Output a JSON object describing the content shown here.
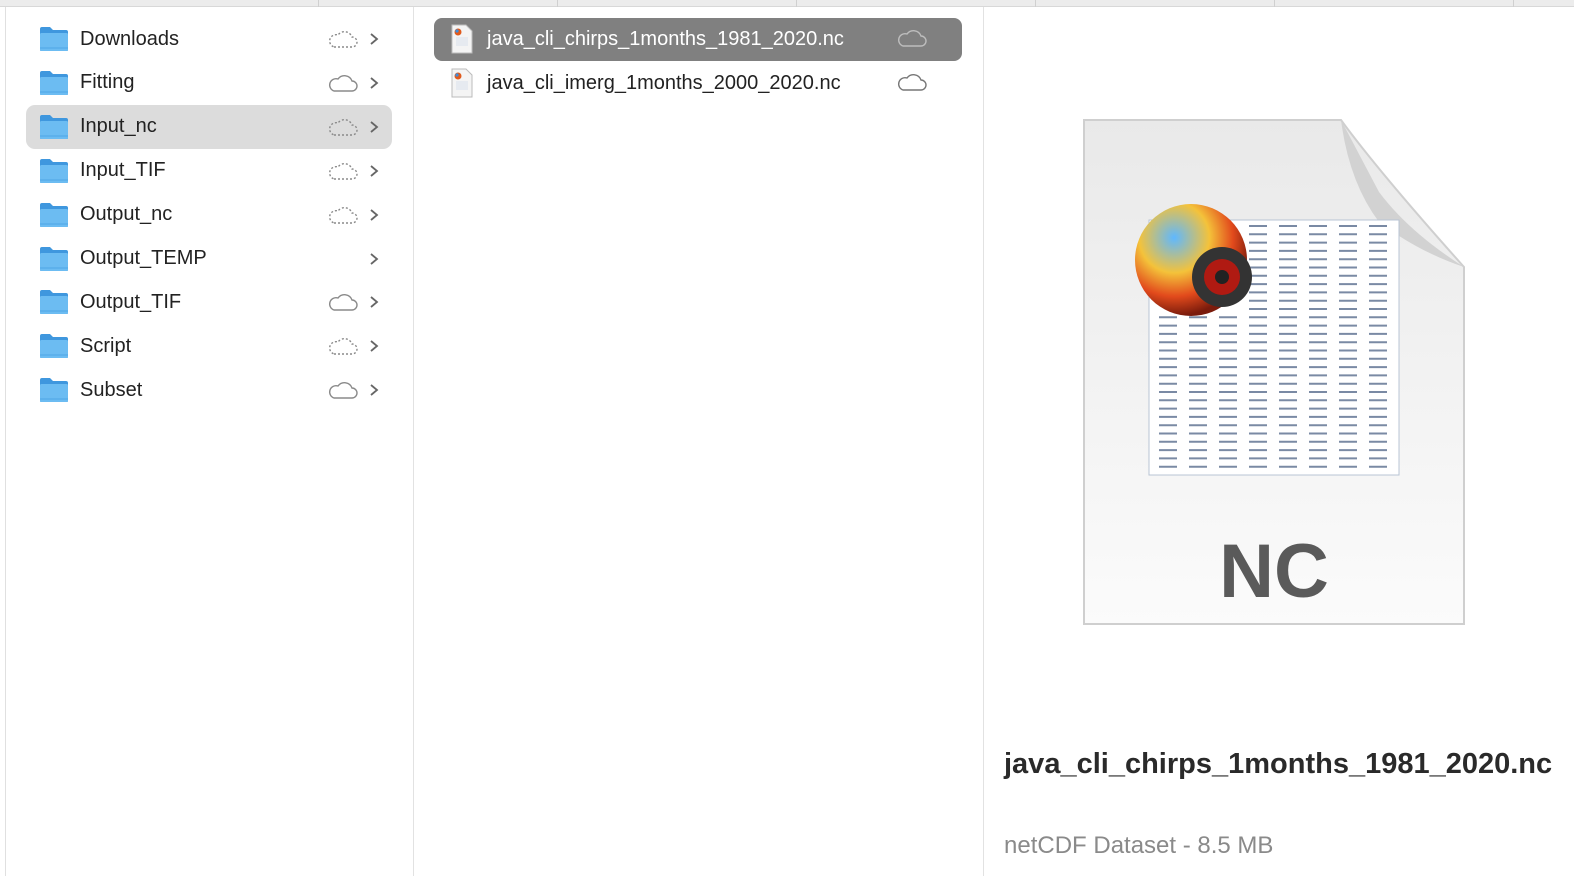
{
  "folders": [
    {
      "label": "Downloads",
      "cloud": "dashed",
      "selected": false
    },
    {
      "label": "Fitting",
      "cloud": "solid",
      "selected": false
    },
    {
      "label": "Input_nc",
      "cloud": "dashed",
      "selected": true
    },
    {
      "label": "Input_TIF",
      "cloud": "dashed",
      "selected": false
    },
    {
      "label": "Output_nc",
      "cloud": "dashed",
      "selected": false
    },
    {
      "label": "Output_TEMP",
      "cloud": "none",
      "selected": false
    },
    {
      "label": "Output_TIF",
      "cloud": "solid",
      "selected": false
    },
    {
      "label": "Script",
      "cloud": "dashed",
      "selected": false
    },
    {
      "label": "Subset",
      "cloud": "solid",
      "selected": false
    }
  ],
  "files": [
    {
      "label": "java_cli_chirps_1months_1981_2020.nc",
      "selected": true
    },
    {
      "label": "java_cli_imerg_1months_2000_2020.nc",
      "selected": false
    }
  ],
  "preview": {
    "title": "java_cli_chirps_1months_1981_2020.nc",
    "subtitle": "netCDF Dataset - 8.5 MB",
    "icon_text": "NC"
  },
  "colors": {
    "selection_active": "#808080",
    "selection_inactive": "#dcdcdc",
    "folder": "#5aaee8"
  }
}
